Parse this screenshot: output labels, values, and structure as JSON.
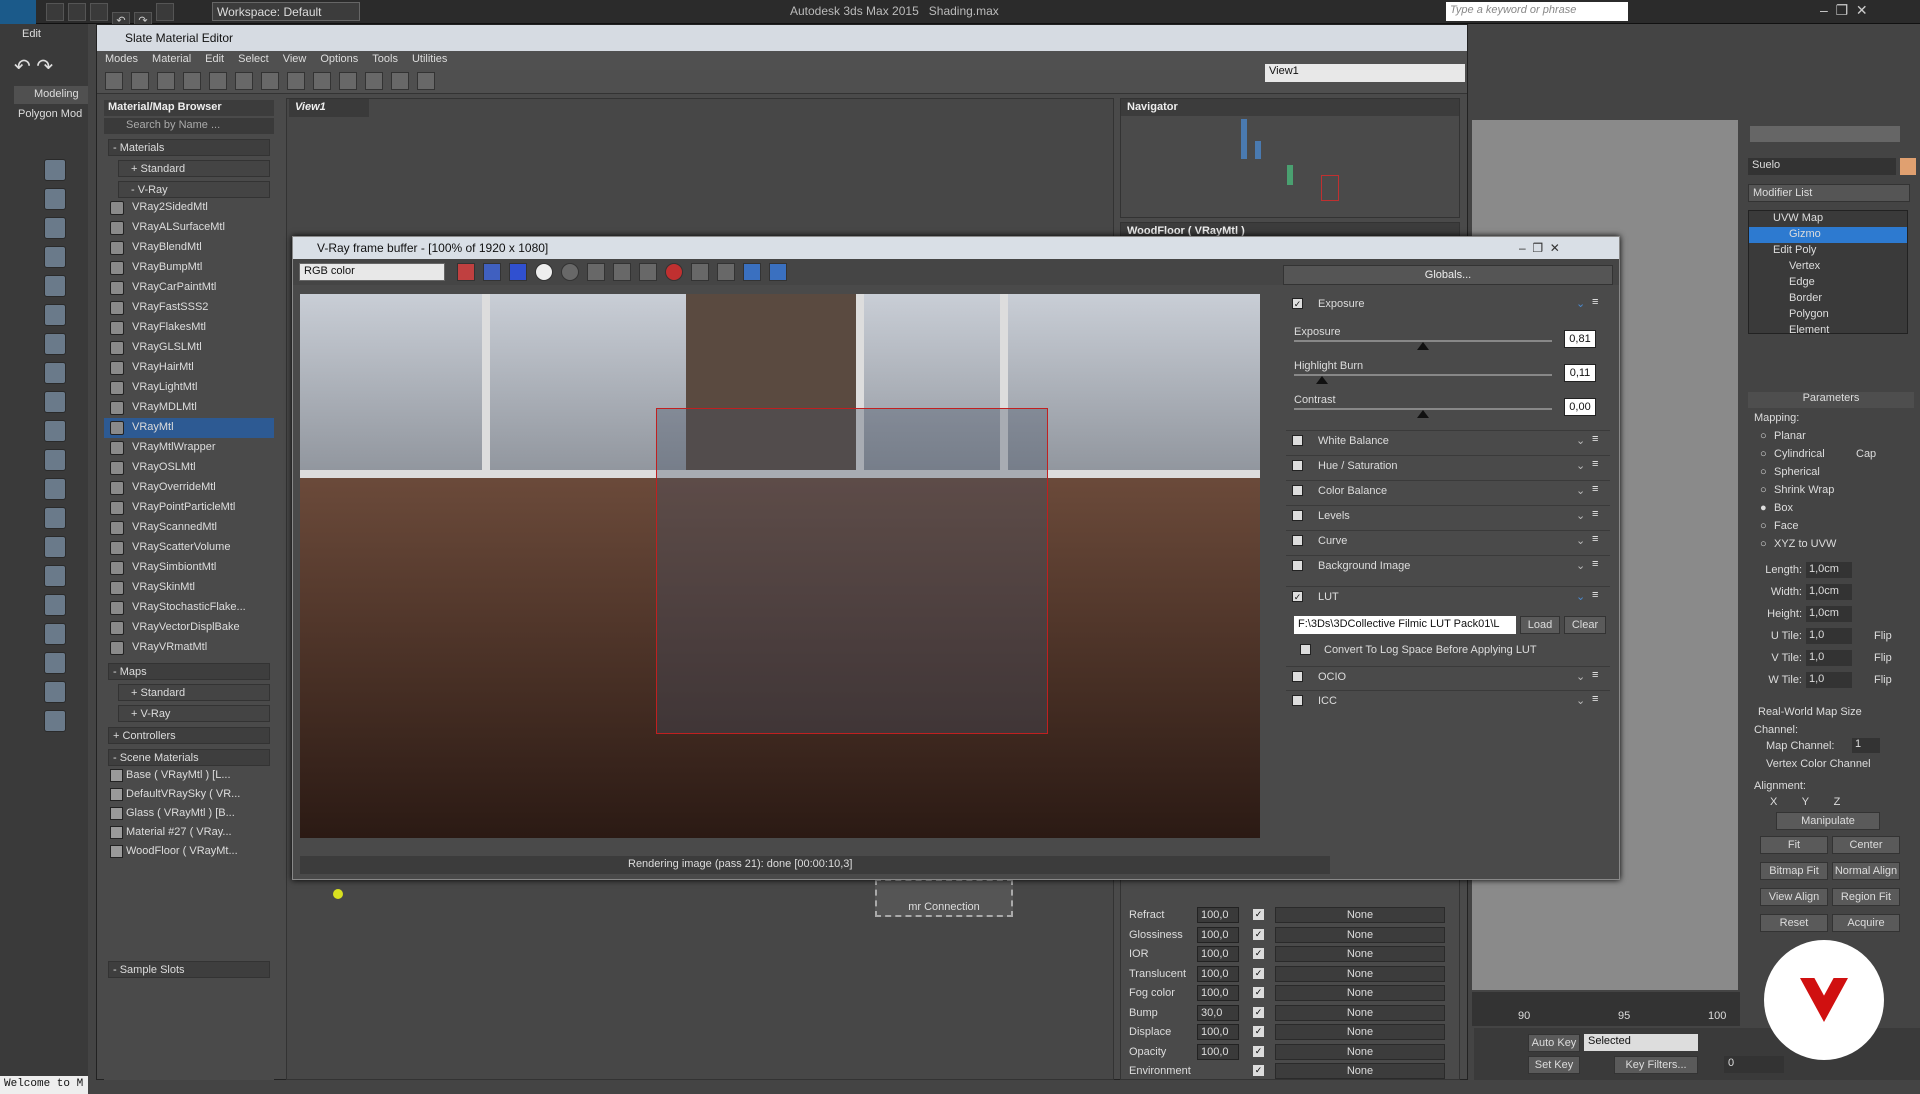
{
  "app": {
    "title": "Autodesk 3ds Max 2015",
    "file": "Shading.max",
    "workspace": "Workspace: Default",
    "search_placeholder": "Type a keyword or phrase",
    "edit_label": "Edit",
    "ribbon": [
      "Modeling",
      "Polygon Mod"
    ],
    "welcome": "Welcome to M"
  },
  "sme": {
    "title": "Slate Material Editor",
    "menu": [
      "Modes",
      "Material",
      "Edit",
      "Select",
      "View",
      "Options",
      "Tools",
      "Utilities"
    ],
    "view_dropdown": "View1",
    "view_tab": "View1",
    "navigator_title": "Navigator",
    "wood_panel_title": "WoodFloor ( VRayMtl )"
  },
  "browser": {
    "title": "Material/Map Browser",
    "search_placeholder": "Search by Name ...",
    "materials_label": "- Materials",
    "standard_label": "+ Standard",
    "vray_label": "- V-Ray",
    "vray_items": [
      "VRay2SidedMtl",
      "VRayALSurfaceMtl",
      "VRayBlendMtl",
      "VRayBumpMtl",
      "VRayCarPaintMtl",
      "VRayFastSSS2",
      "VRayFlakesMtl",
      "VRayGLSLMtl",
      "VRayHairMtl",
      "VRayLightMtl",
      "VRayMDLMtl",
      "VRayMtl",
      "VRayMtlWrapper",
      "VRayOSLMtl",
      "VRayOverrideMtl",
      "VRayPointParticleMtl",
      "VRayScannedMtl",
      "VRayScatterVolume",
      "VRaySimbiontMtl",
      "VRaySkinMtl",
      "VRayStochasticFlake...",
      "VRayVectorDisplBake",
      "VRayVRmatMtl"
    ],
    "maps_label": "- Maps",
    "maps_standard": "+ Standard",
    "maps_vray": "+ V-Ray",
    "controllers": "+ Controllers",
    "scene_label": "- Scene Materials",
    "scene_items": [
      "Base ( VRayMtl ) [L...",
      "DefaultVRaySky ( VR...",
      "Glass ( VRayMtl ) [B...",
      "Material #27 ( VRay...",
      "WoodFloor ( VRayMt..."
    ],
    "sample_slots": "- Sample Slots"
  },
  "woodparams": [
    {
      "label": "Refract",
      "value": "100,0",
      "map": "None"
    },
    {
      "label": "Glossiness",
      "value": "100,0",
      "map": "None"
    },
    {
      "label": "IOR",
      "value": "100,0",
      "map": "None"
    },
    {
      "label": "Translucent",
      "value": "100,0",
      "map": "None"
    },
    {
      "label": "Fog color",
      "value": "100,0",
      "map": "None"
    },
    {
      "label": "Bump",
      "value": "30,0",
      "map": "None"
    },
    {
      "label": "Displace",
      "value": "100,0",
      "map": "None"
    },
    {
      "label": "Opacity",
      "value": "100,0",
      "map": "None"
    },
    {
      "label": "Environment",
      "value": "",
      "map": "None"
    }
  ],
  "node": {
    "label": "mr Connection"
  },
  "vfb": {
    "title": "V-Ray frame buffer - [100% of 1920 x 1080]",
    "channel": "RGB color",
    "globals": "Globals...",
    "status": "Rendering image (pass 21): done [00:00:10,3]",
    "exposure_label": "Exposure",
    "exposure": {
      "label": "Exposure",
      "value": "0,81",
      "level": 0.5
    },
    "highlight": {
      "label": "Highlight Burn",
      "value": "0,11",
      "level": 0.11
    },
    "contrast": {
      "label": "Contrast",
      "value": "0,00",
      "level": 0.5
    },
    "sections": [
      "White Balance",
      "Hue / Saturation",
      "Color Balance",
      "Levels",
      "Curve",
      "Background Image"
    ],
    "lut_label": "LUT",
    "lut_path": "F:\\3Ds\\3DCollective Filmic LUT Pack01\\L",
    "load": "Load",
    "clear": "Clear",
    "log_space": "Convert To Log Space Before Applying LUT",
    "ocio": "OCIO",
    "icc": "ICC"
  },
  "cmd": {
    "object_name": "Suelo",
    "modifier_list": "Modifier List",
    "stack": [
      "UVW Map",
      "Gizmo",
      "Edit Poly",
      "Vertex",
      "Edge",
      "Border",
      "Polygon",
      "Element"
    ],
    "parameters": "Parameters",
    "mapping": "Mapping:",
    "mapping_types": [
      "Planar",
      "Cylindrical",
      "Spherical",
      "Shrink Wrap",
      "Box",
      "Face",
      "XYZ to UVW"
    ],
    "cap": "Cap",
    "length": {
      "label": "Length:",
      "value": "1,0cm"
    },
    "width": {
      "label": "Width:",
      "value": "1,0cm"
    },
    "height": {
      "label": "Height:",
      "value": "1,0cm"
    },
    "utile": {
      "label": "U Tile:",
      "value": "1,0"
    },
    "vtile": {
      "label": "V Tile:",
      "value": "1,0"
    },
    "wtile": {
      "label": "W Tile:",
      "value": "1,0"
    },
    "flip": "Flip",
    "realworld": "Real-World Map Size",
    "channel": "Channel:",
    "map_channel": "Map Channel:",
    "map_channel_value": "1",
    "vertex_color": "Vertex Color Channel",
    "alignment": "Alignment:",
    "axes": [
      "X",
      "Y",
      "Z"
    ],
    "manipulate": "Manipulate",
    "buttons": [
      "Fit",
      "Center",
      "Bitmap Fit",
      "Normal Align",
      "View Align",
      "Region Fit",
      "Reset",
      "Acquire"
    ]
  },
  "timeline": {
    "ticks": [
      "90",
      "95",
      "100"
    ],
    "auto_key": "Auto Key",
    "set_key": "Set Key",
    "selected": "Selected",
    "key_filters": "Key Filters...",
    "frame": "0"
  }
}
